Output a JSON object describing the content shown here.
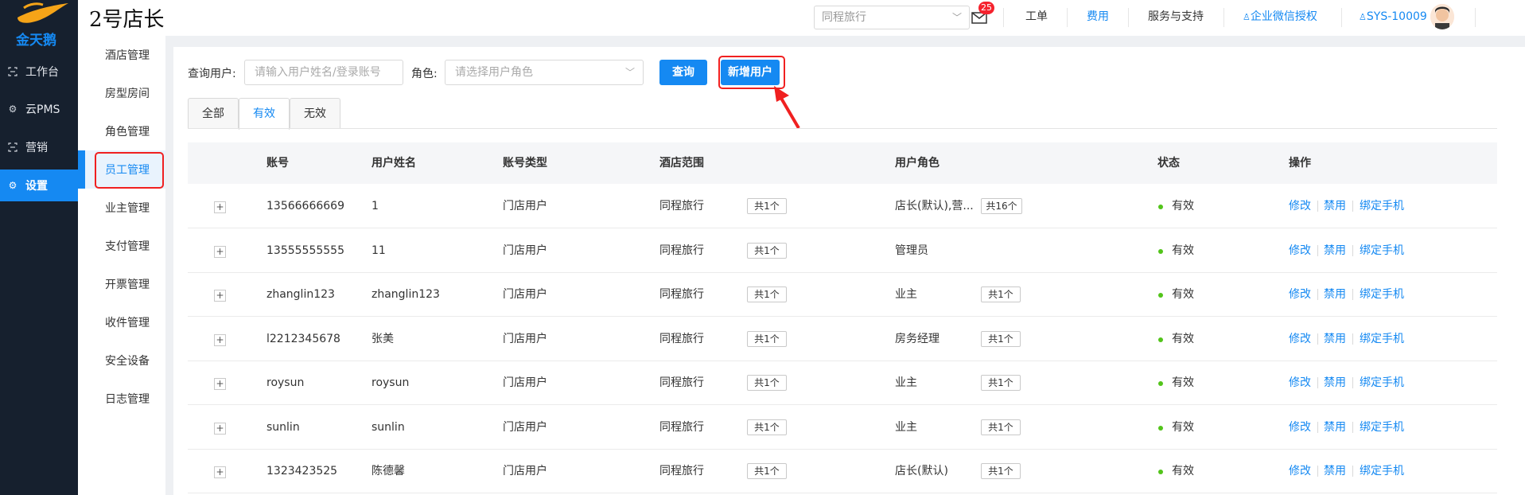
{
  "brand": {
    "logo_text": "金天鹅",
    "app_title": "2号店长"
  },
  "sidebar": {
    "items": [
      {
        "label": "工作台",
        "icon": "schedule-icon"
      },
      {
        "label": "云PMS",
        "icon": "gear-icon"
      },
      {
        "label": "营销",
        "icon": "schedule-icon"
      },
      {
        "label": "设置",
        "icon": "gear-icon",
        "active": true
      }
    ]
  },
  "submenu": {
    "items": [
      "酒店管理",
      "房型房间",
      "角色管理",
      "员工管理",
      "业主管理",
      "支付管理",
      "开票管理",
      "收件管理",
      "安全设备",
      "日志管理"
    ],
    "active": "员工管理"
  },
  "header": {
    "hotel_select": "同程旅行",
    "mail_count": "25",
    "nav": [
      "工单",
      "费用",
      "服务与支持",
      "企业微信授权",
      "SYS-10009"
    ]
  },
  "filters": {
    "user_label": "查询用户:",
    "user_placeholder": "请输入用户姓名/登录账号",
    "role_label": "角色:",
    "role_placeholder": "请选择用户角色",
    "query_button": "查询",
    "add_button": "新增用户"
  },
  "tabs": [
    "全部",
    "有效",
    "无效"
  ],
  "active_tab": "有效",
  "table": {
    "columns": [
      "账号",
      "用户姓名",
      "账号类型",
      "酒店范围",
      "用户角色",
      "状态",
      "操作"
    ],
    "rows": [
      {
        "account": "13566666669",
        "name": "1",
        "type": "门店用户",
        "hotel": "同程旅行",
        "hotel_count": "共1个",
        "role": "店长(默认),营...",
        "role_count": "共16个",
        "status": "有效"
      },
      {
        "account": "13555555555",
        "name": "11",
        "type": "门店用户",
        "hotel": "同程旅行",
        "hotel_count": "共1个",
        "role": "管理员",
        "role_count": "",
        "status": "有效"
      },
      {
        "account": "zhanglin123",
        "name": "zhanglin123",
        "type": "门店用户",
        "hotel": "同程旅行",
        "hotel_count": "共1个",
        "role": "业主",
        "role_count": "共1个",
        "status": "有效"
      },
      {
        "account": "l2212345678",
        "name": "张美",
        "type": "门店用户",
        "hotel": "同程旅行",
        "hotel_count": "共1个",
        "role": "房务经理",
        "role_count": "共1个",
        "status": "有效"
      },
      {
        "account": "roysun",
        "name": "roysun",
        "type": "门店用户",
        "hotel": "同程旅行",
        "hotel_count": "共1个",
        "role": "业主",
        "role_count": "共1个",
        "status": "有效"
      },
      {
        "account": "sunlin",
        "name": "sunlin",
        "type": "门店用户",
        "hotel": "同程旅行",
        "hotel_count": "共1个",
        "role": "业主",
        "role_count": "共1个",
        "status": "有效"
      },
      {
        "account": "1323423525",
        "name": "陈德馨",
        "type": "门店用户",
        "hotel": "同程旅行",
        "hotel_count": "共1个",
        "role": "店长(默认)",
        "role_count": "共1个",
        "status": "有效"
      }
    ],
    "actions": [
      "修改",
      "禁用",
      "绑定手机"
    ],
    "expand_symbol": "+"
  },
  "colors": {
    "primary": "#1589f2",
    "sidebar_bg": "#16202e",
    "highlight": "#f02020",
    "status_ok": "#52c41a"
  }
}
